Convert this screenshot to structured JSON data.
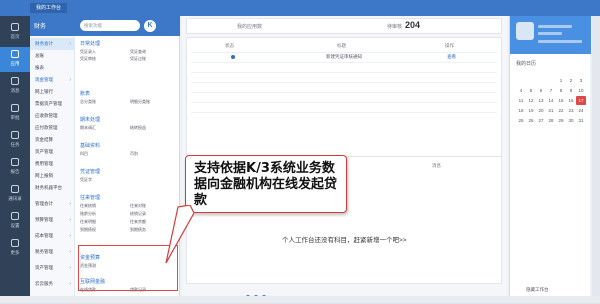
{
  "topbar": {
    "tab": "我的工作台"
  },
  "rail": [
    {
      "label": "首页",
      "active": false
    },
    {
      "label": "应用",
      "active": true
    },
    {
      "label": "消息",
      "active": false
    },
    {
      "label": "审批",
      "active": false
    },
    {
      "label": "任务",
      "active": false
    },
    {
      "label": "报告",
      "active": false
    },
    {
      "label": "通讯录",
      "active": false
    },
    {
      "label": "设置",
      "active": false
    },
    {
      "label": "更多",
      "active": false
    }
  ],
  "menu": {
    "title": "财务",
    "search_placeholder": "搜索功能",
    "logo": "K",
    "categories": [
      "财务会计",
      "总账",
      "报表",
      "现金管理",
      "网上银行",
      "票据资产管理",
      "应收款管理",
      "应付款管理",
      "资金结算",
      "资产管理",
      "费用管理",
      "网上报销",
      "财务机器平台",
      "管理会计",
      "预算管理",
      "成本管理",
      "税务管理",
      "资产管理",
      "云云服务",
      "共享服务"
    ],
    "groups": [
      {
        "title": "日常处理",
        "items": [
          "凭证录入",
          "凭证查询",
          "凭证审核",
          "凭证过账"
        ]
      },
      {
        "title": "账表",
        "items": [
          "总分类账",
          "明细分类账"
        ]
      },
      {
        "title": "期末处理",
        "items": [
          "期末调汇",
          "结转损益"
        ]
      },
      {
        "title": "基础资料",
        "items": [
          "科目",
          "币别"
        ]
      },
      {
        "title": "凭证管理",
        "items": [
          "凭证字"
        ]
      },
      {
        "title": "往来管理",
        "items": [
          "往来核销",
          "往来对账",
          "账龄分析",
          "核销记录",
          "往来明细",
          "往来余额",
          "到期债权",
          "到期债务"
        ]
      },
      {
        "title": "资金预算",
        "items": [
          "资金预测"
        ]
      },
      {
        "title": "互联网金融",
        "items": [
          "在线贷款",
          "贷款记录"
        ]
      }
    ]
  },
  "main": {
    "top_label_1": "我的应用数",
    "top_label_2": "待审核",
    "top_number": "204",
    "table_headers": [
      "状态",
      "标题",
      "操作"
    ],
    "table_row": {
      "title": "新建凭证审核通知",
      "action": "查看"
    },
    "bottom_tab": "消息",
    "empty_message": "个人工作台还没有科目，赶紧新增一个吧>>"
  },
  "callout": {
    "text": "支持依据K/3系统业务数据向金融机构在线发起贷款"
  },
  "right": {
    "calendar_title": "我的日历",
    "calendar_days": [
      "1",
      "2",
      "3",
      "4",
      "5",
      "6",
      "7",
      "8",
      "9",
      "10",
      "11",
      "12",
      "13",
      "14",
      "15",
      "16",
      "17",
      "18",
      "19",
      "20",
      "21",
      "22",
      "23",
      "24",
      "25",
      "26",
      "27",
      "28",
      "29",
      "30",
      "31"
    ],
    "today": "17",
    "footer": "隐藏工作台"
  },
  "colors": {
    "accent": "#3d78c8",
    "rail": "#2f4257",
    "highlight": "#e04848"
  }
}
